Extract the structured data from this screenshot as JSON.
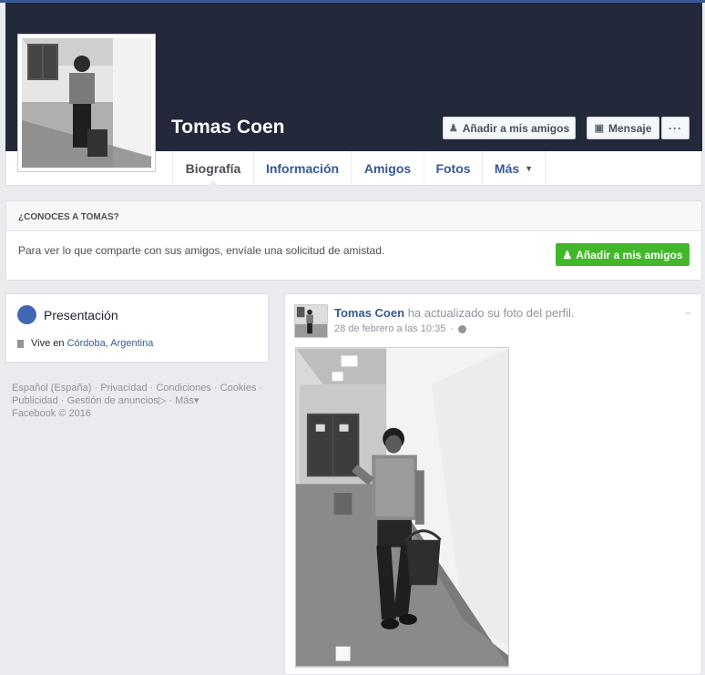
{
  "profile": {
    "name": "Tomas Coen",
    "add_friend_label": "Añadir a mis amigos",
    "message_label": "Mensaje",
    "more_label": "···"
  },
  "tabs": [
    {
      "label": "Biografía",
      "active": true
    },
    {
      "label": "Información"
    },
    {
      "label": "Amigos"
    },
    {
      "label": "Fotos"
    },
    {
      "label": "Más"
    }
  ],
  "know": {
    "heading": "¿CONOCES A TOMAS?",
    "text_start": "Para ver lo que comparte con sus amigos, ",
    "text_link": "envíale una solicitud de amistad.",
    "button_label": "Añadir a mis amigos"
  },
  "intro": {
    "title": "Presentación",
    "lives_prefix": "Vive en",
    "city": "Córdoba, Argentina"
  },
  "footer": {
    "links": [
      "Español (España)",
      "Privacidad",
      "Condiciones",
      "Cookies",
      "Publicidad",
      "Gestión de anuncios",
      "Más"
    ],
    "copyright": "Facebook © 2016"
  },
  "post": {
    "author": "Tomas Coen",
    "action": "ha actualizado su foto del perfil.",
    "timestamp": "28 de febrero a las 10:35"
  },
  "colors": {
    "cover": "#23283a",
    "link": "#365899",
    "green_button": "#42b72a",
    "page_bg": "#e9ebee"
  }
}
